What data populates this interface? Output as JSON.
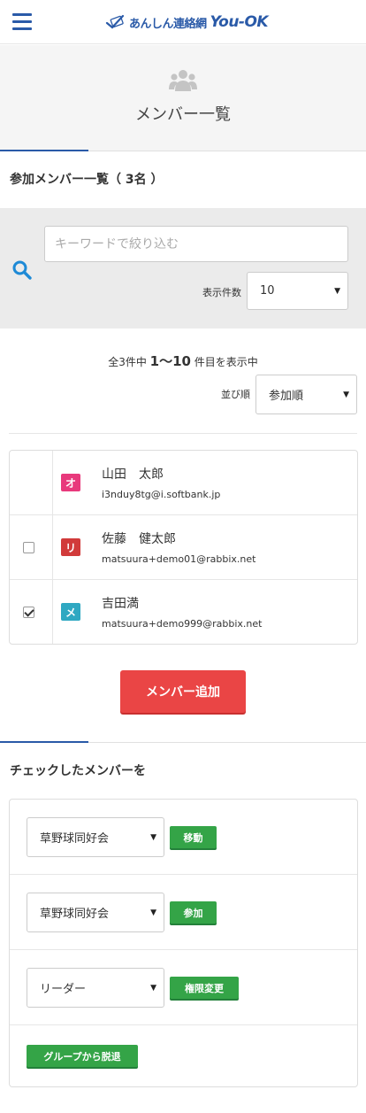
{
  "header": {
    "logo_text": "あんしん連絡網",
    "logo_brand": "You-OK",
    "menu_icon": "hamburger-icon"
  },
  "page": {
    "icon": "group-icon",
    "title": "メンバー一覧"
  },
  "members_section": {
    "title": "参加メンバー一覧（ 3名 ）",
    "search_placeholder": "キーワードで絞り込む",
    "search_icon": "search-icon",
    "per_page_label": "表示件数",
    "per_page_value": "10",
    "count_prefix": "全3件中 ",
    "count_range": "1〜10",
    "count_suffix": " 件目を表示中",
    "sort_label": "並び順",
    "sort_value": "参加順",
    "members": [
      {
        "initial": "オ",
        "color": "#e8397c",
        "name": "山田　太郎",
        "email": "i3nduy8tg@i.softbank.jp",
        "has_checkbox": false,
        "checked": false
      },
      {
        "initial": "リ",
        "color": "#d13a3a",
        "name": "佐藤　健太郎",
        "email": "matsuura+demo01@rabbix.net",
        "has_checkbox": true,
        "checked": false
      },
      {
        "initial": "メ",
        "color": "#2fa8c2",
        "name": "吉田満",
        "email": "matsuura+demo999@rabbix.net",
        "has_checkbox": true,
        "checked": true
      }
    ],
    "add_button": "メンバー追加"
  },
  "actions_section": {
    "title": "チェックしたメンバーを",
    "move_select": "草野球同好会",
    "move_button": "移動",
    "join_select": "草野球同好会",
    "join_button": "参加",
    "role_select": "リーダー",
    "role_button": "権限変更",
    "leave_button": "グループから脱退"
  },
  "colors": {
    "brand_blue": "#2a5aa8",
    "danger_red": "#ea4545",
    "success_green": "#34a447",
    "search_blue": "#1e8ad6"
  }
}
